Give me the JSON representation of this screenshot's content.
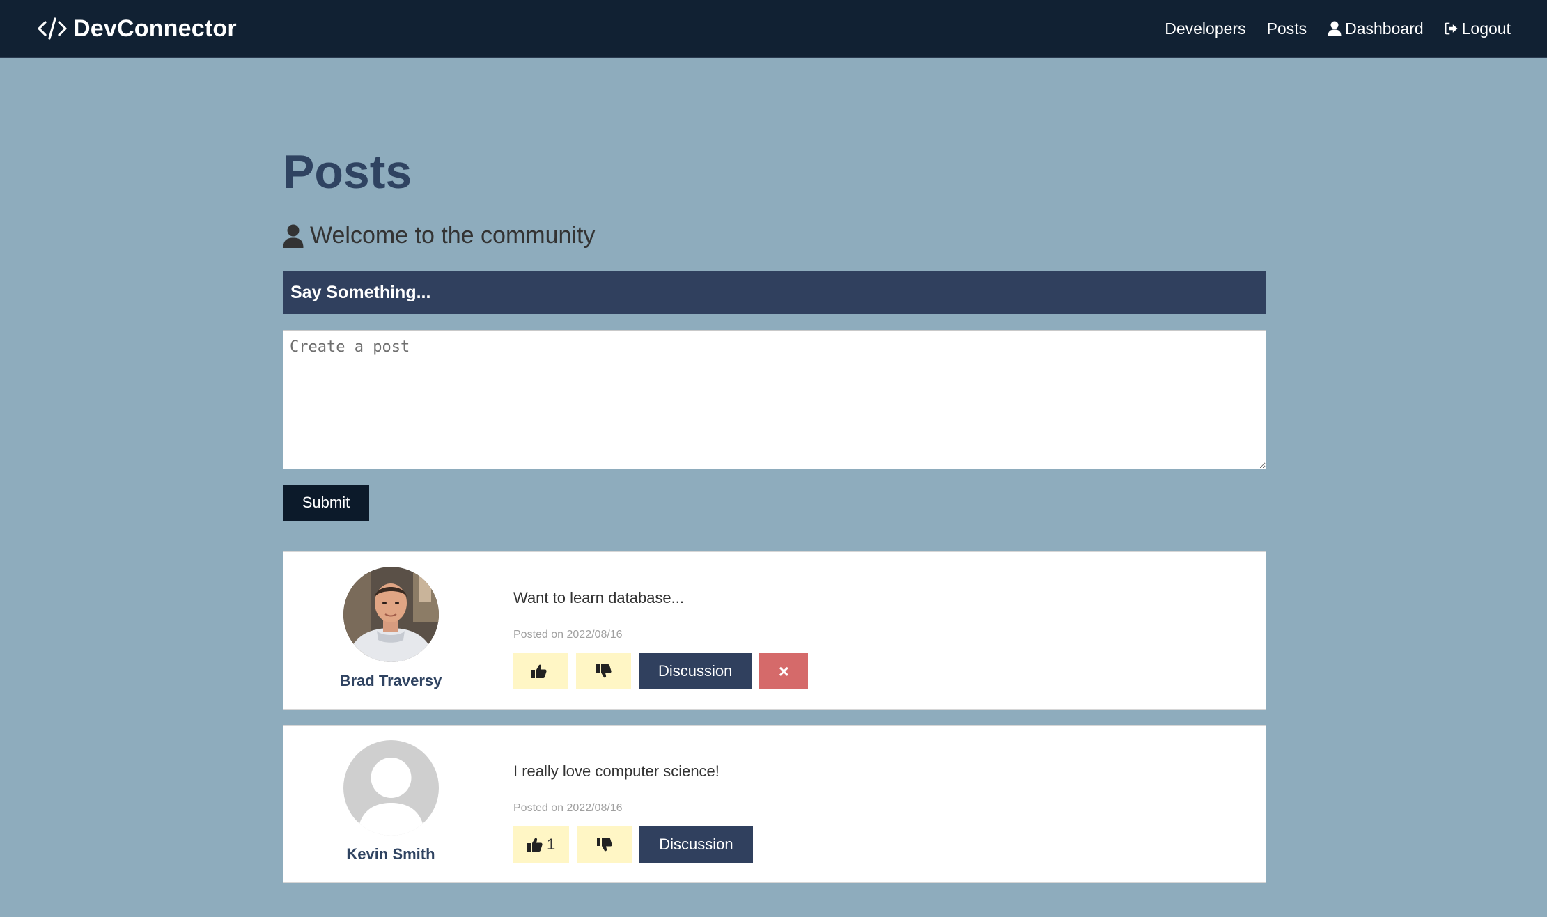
{
  "navbar": {
    "brand": "DevConnector",
    "links": {
      "developers": "Developers",
      "posts": "Posts",
      "dashboard": "Dashboard",
      "logout": "Logout"
    }
  },
  "page": {
    "title": "Posts",
    "lead": "Welcome to the community"
  },
  "post_form": {
    "header": "Say Something...",
    "placeholder": "Create a post",
    "value": "",
    "submit_label": "Submit"
  },
  "posts": [
    {
      "author": "Brad Traversy",
      "text": "Want to learn database...",
      "date": "Posted on 2022/08/16",
      "likes": "",
      "discussion_label": "Discussion",
      "delete_label": "×",
      "avatar": "author-photo"
    },
    {
      "author": "Kevin Smith",
      "text": "I really love computer science!",
      "date": "Posted on 2022/08/16",
      "likes": "1",
      "discussion_label": "Discussion",
      "avatar": "default-avatar"
    }
  ],
  "icons": {
    "brand": "code-icon",
    "dashboard": "user-icon",
    "logout": "sign-out-icon",
    "lead": "user-icon",
    "like": "thumbs-up-icon",
    "unlike": "thumbs-down-icon"
  },
  "colors": {
    "navbar": "#112133",
    "background": "#8eacbd",
    "primary": "#30405e",
    "dark": "#0c1a2a",
    "like_button": "#fff6c5",
    "danger": "#d56a6a",
    "title": "#2f4361"
  }
}
